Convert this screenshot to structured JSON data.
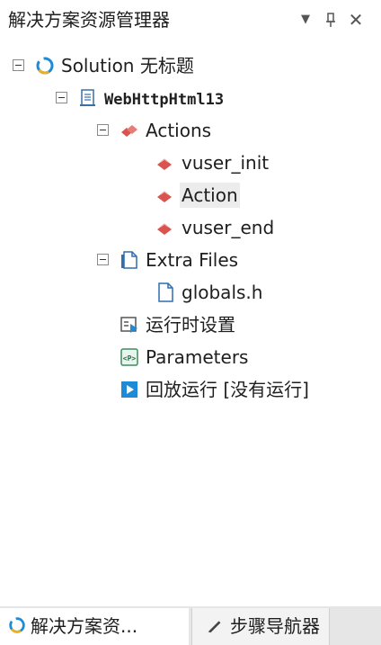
{
  "panel": {
    "title": "解决方案资源管理器",
    "buttons": {
      "menu": "▼",
      "pin": "ㅁ",
      "close": "✕"
    }
  },
  "tree": {
    "solution": {
      "label": "Solution 无标题",
      "icon": "solution-icon"
    },
    "script": {
      "label": "WebHttpHtml13",
      "icon": "script-document-icon"
    },
    "actions_folder": {
      "label": "Actions",
      "icon": "actions-icon"
    },
    "actions": [
      {
        "label": "vuser_init",
        "icon": "action-icon",
        "selected": false
      },
      {
        "label": "Action",
        "icon": "action-icon",
        "selected": true
      },
      {
        "label": "vuser_end",
        "icon": "action-icon",
        "selected": false
      }
    ],
    "extra_files": {
      "label": "Extra Files",
      "icon": "extra-files-icon"
    },
    "globals": {
      "label": "globals.h",
      "icon": "file-icon"
    },
    "runtime_settings": {
      "label": "运行时设置",
      "icon": "runtime-settings-icon"
    },
    "parameters": {
      "label": "Parameters",
      "icon": "parameters-icon"
    },
    "replay": {
      "label": "回放运行 [没有运行]",
      "icon": "play-icon"
    }
  },
  "tabs": [
    {
      "label": "解决方案资...",
      "icon": "solution-icon",
      "active": true
    },
    {
      "label": "步骤导航器",
      "icon": "pen-icon",
      "active": false
    }
  ],
  "colors": {
    "accent_blue": "#1e8bd6",
    "action_red": "#d9534f",
    "selected_bg": "#ececec"
  }
}
